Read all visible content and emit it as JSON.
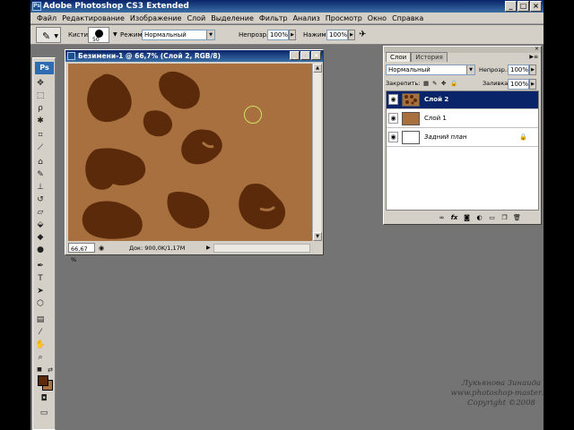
{
  "app": {
    "title": "Adobe Photoshop CS3 Extended",
    "logo": "Ps",
    "window_buttons": [
      "_",
      "□",
      "×"
    ]
  },
  "menu": [
    "Файл",
    "Редактирование",
    "Изображение",
    "Слой",
    "Выделение",
    "Фильтр",
    "Анализ",
    "Просмотр",
    "Окно",
    "Справка"
  ],
  "options": {
    "brushes_label": "Кисти:",
    "brush_size": "50",
    "mode_label": "Режим:",
    "mode_value": "Нормальный",
    "opacity_label": "Непрозр.:",
    "opacity_value": "100%",
    "flow_label": "Нажим:",
    "flow_value": "100%"
  },
  "document": {
    "title": "Безимени-1 @ 66,7% (Слой 2, RGB/8)",
    "zoom": "66,67 %",
    "doc_info": "Док: 900,0K/1,17M",
    "canvas_color": "#a8703f",
    "blob_color": "#5a2a0a",
    "window_buttons": [
      "_",
      "□",
      "×"
    ]
  },
  "layers_panel": {
    "tabs": [
      "Слои",
      "История"
    ],
    "blend_mode": "Нормальный",
    "opacity_label": "Непрозр.:",
    "opacity_value": "100%",
    "lock_label": "Закрепить:",
    "fill_label": "Заливка:",
    "fill_value": "100%",
    "layers": [
      {
        "name": "Слой 2",
        "selected": true,
        "thumb": "spots"
      },
      {
        "name": "Слой 1",
        "selected": false,
        "thumb": "brown"
      },
      {
        "name": "Задний план",
        "selected": false,
        "thumb": "white",
        "locked": true
      }
    ],
    "footer_icons": [
      "link-icon",
      "fx-icon",
      "mask-icon",
      "adjustment-icon",
      "folder-icon",
      "new-layer-icon",
      "trash-icon"
    ]
  },
  "toolbox": {
    "foreground_color": "#5a2a0a",
    "background_color": "#a8703f"
  },
  "watermark": {
    "line1": "Лукьянова Зинаида",
    "line2": "www.photoshop-master.ru",
    "line3": "Copyright ©2008"
  }
}
